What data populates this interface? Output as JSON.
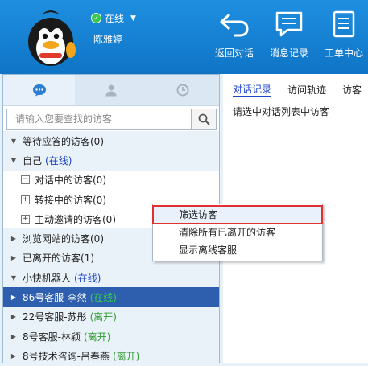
{
  "header": {
    "status": "在线",
    "username": "陈雅婷",
    "buttons": [
      {
        "label": "返回对话",
        "icon": "return-arrow-icon"
      },
      {
        "label": "消息记录",
        "icon": "message-record-icon"
      },
      {
        "label": "工单中心",
        "icon": "ticket-center-icon"
      }
    ]
  },
  "left": {
    "tabs": [
      "chat-bubble-icon",
      "user-icon",
      "clock-icon"
    ],
    "search_placeholder": "请输入您要查找的访客",
    "tree": [
      {
        "label": "等待应答的访客(0)",
        "expand": "▼"
      },
      {
        "label": "自己",
        "status": "(在线)",
        "expand": "▼"
      },
      {
        "label": "对话中的访客(0)",
        "box": "−"
      },
      {
        "label": "转接中的访客(0)",
        "box": "+"
      },
      {
        "label": "主动邀请的访客(0)",
        "box": "+"
      },
      {
        "label": "浏览网站的访客(0)",
        "expand": "▶"
      },
      {
        "label": "已离开的访客(1)",
        "expand": "▶"
      },
      {
        "label": "小快机器人",
        "status": "(在线)",
        "expand": "▼"
      },
      {
        "label": "86号客服-李然",
        "status": "(在线)",
        "expand": "▶"
      },
      {
        "label": "22号客服-苏彤",
        "status": "(离开)",
        "expand": "▶"
      },
      {
        "label": "8号客服-林颖",
        "status": "(离开)",
        "expand": "▶"
      },
      {
        "label": "8号技术咨询-吕春燕",
        "status": "(离开)",
        "expand": "▶"
      }
    ]
  },
  "right": {
    "tabs": [
      "对话记录",
      "访问轨迹",
      "访客"
    ],
    "hint": "请选中对话列表中访客"
  },
  "context_menu": {
    "items": [
      "筛选访客",
      "清除所有已离开的访客",
      "显示离线客服"
    ]
  }
}
